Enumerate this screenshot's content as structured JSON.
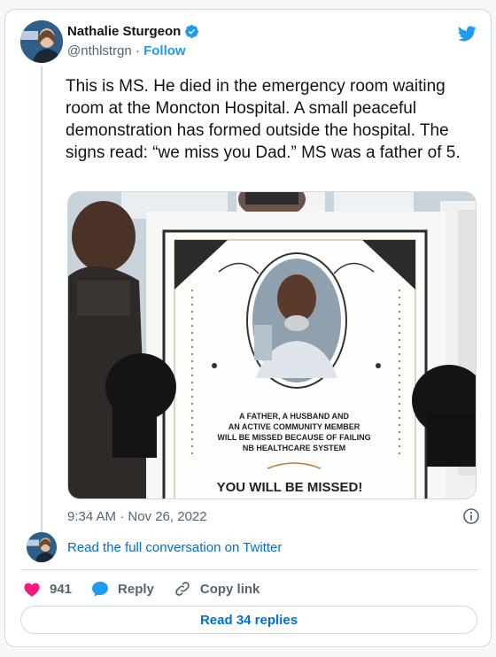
{
  "author": {
    "name": "Nathalie Sturgeon",
    "handle": "@nthlstrgn",
    "separator": "·",
    "follow_label": "Follow"
  },
  "tweet": {
    "text": "This is MS. He died in the emergency room waiting room at the Moncton Hospital. A small peaceful demonstration has formed outside the hospital. The signs read: “we miss you Dad.” MS was a father of 5.",
    "timestamp": "9:34 AM · Nov 26, 2022"
  },
  "media": {
    "sign_caption": "A FATHER, A HUSBAND AND AN ACTIVE COMMUNITY MEMBER WILL BE MISSED BECAUSE OF FAILING NB HEALTHCARE SYSTEM",
    "sign_caption_lines": [
      "A FATHER, A HUSBAND AND",
      "AN ACTIVE COMMUNITY MEMBER",
      "WILL BE MISSED BECAUSE OF FAILING",
      "NB HEALTHCARE SYSTEM"
    ],
    "sign_headline": "YOU WILL BE MISSED!"
  },
  "conversation": {
    "link_label": "Read the full conversation on Twitter"
  },
  "actions": {
    "like_count": "941",
    "reply_label": "Reply",
    "copy_link_label": "Copy link"
  },
  "read_replies_label": "Read 34 replies",
  "colors": {
    "accent": "#1d9bf0",
    "link": "#006fd6",
    "like": "#f91880",
    "muted": "#536471"
  },
  "icons": [
    "verified-badge-icon",
    "twitter-bird-icon",
    "info-icon",
    "heart-icon",
    "reply-bubble-icon",
    "link-icon"
  ]
}
